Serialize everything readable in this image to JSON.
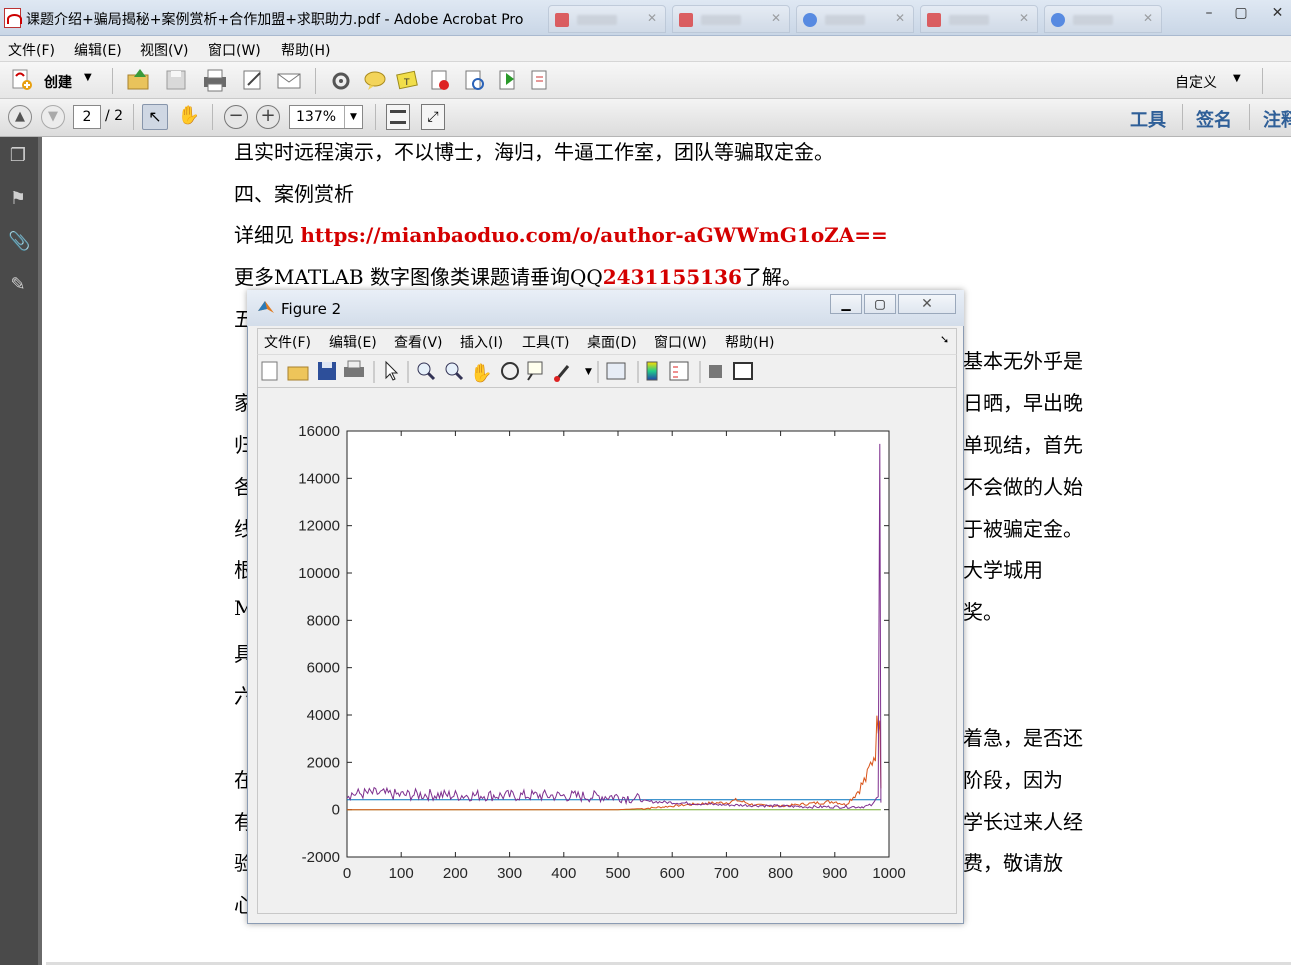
{
  "window": {
    "title": "课题介绍+骗局揭秘+案例赏析+合作加盟+求职助力.pdf - Adobe Acrobat Pro",
    "controls": {
      "minimize": "–",
      "maximize": "▢",
      "close": "✕"
    }
  },
  "menu": [
    "文件(F)",
    "编辑(E)",
    "视图(V)",
    "窗口(W)",
    "帮助(H)"
  ],
  "toolbar": {
    "create_label": "创建",
    "customize_label": "自定义",
    "icons": [
      "open-icon",
      "save-icon",
      "print-icon",
      "edit-icon",
      "email-icon",
      "settings-icon",
      "comment-icon",
      "stamp-icon",
      "delete-page-icon",
      "export-icon",
      "share-icon",
      "form-icon"
    ]
  },
  "nav": {
    "page_current": "2",
    "page_total": "/ 2",
    "zoom": "137%",
    "tools_label": "工具",
    "sign_label": "签名",
    "comment_label": "注释"
  },
  "document": {
    "line1": "且实时远程演示，不以博士，海归，牛逼工作室，团队等骗取定金。",
    "line2": "四、案例赏析",
    "line3_prefix": "详细见 ",
    "line3_link": "https://mianbaoduo.com/o/author-aGWWmG1oZA==",
    "line4_prefix": "更多MATLAB  数字图像类课题请垂询QQ",
    "line4_qq": "2431155136",
    "line4_suffix": "了解。",
    "left_fragments": [
      "五",
      "家",
      "归",
      "各",
      "线",
      "根",
      "M",
      "具",
      "六",
      "在",
      "有",
      "验",
      "心"
    ],
    "right_fragments": [
      "基本无外乎是",
      "日晒，早出晚",
      "单现结，首先",
      "不会做的人始",
      "于被骗定金。",
      "大学城用",
      "奖。",
      "着急，是否还",
      "阶段，因为",
      "学长过来人经",
      "费，敬请放"
    ]
  },
  "figure": {
    "title": "Figure 2",
    "menu": [
      "文件(F)",
      "编辑(E)",
      "查看(V)",
      "插入(I)",
      "工具(T)",
      "桌面(D)",
      "窗口(W)",
      "帮助(H)"
    ],
    "tools": [
      "new-icon",
      "open-icon",
      "save-icon",
      "print-icon",
      "pointer-icon",
      "zoom-in-icon",
      "zoom-out-icon",
      "pan-icon",
      "rotate-icon",
      "datatip-icon",
      "brush-icon",
      "link-icon",
      "colorbar-icon",
      "legend-icon",
      "hide-tools-icon",
      "dock-icon"
    ]
  },
  "chart_data": {
    "type": "line",
    "title": "",
    "xlabel": "",
    "ylabel": "",
    "xlim": [
      0,
      1000
    ],
    "ylim": [
      -2000,
      16000
    ],
    "xticks": [
      0,
      100,
      200,
      300,
      400,
      500,
      600,
      700,
      800,
      900,
      1000
    ],
    "yticks": [
      -2000,
      0,
      2000,
      4000,
      6000,
      8000,
      10000,
      12000,
      14000,
      16000
    ],
    "grid": false,
    "series": [
      {
        "color": "#7e2f8e",
        "x": [
          0,
          50,
          100,
          150,
          200,
          250,
          300,
          350,
          400,
          450,
          500,
          530,
          550,
          600,
          650,
          700,
          750,
          800,
          850,
          900,
          950,
          970,
          980,
          983,
          985
        ],
        "y": [
          650,
          700,
          620,
          640,
          600,
          610,
          590,
          600,
          580,
          560,
          560,
          480,
          350,
          300,
          250,
          200,
          180,
          150,
          120,
          120,
          120,
          200,
          600,
          15500,
          300
        ]
      },
      {
        "color": "#d95319",
        "x": [
          0,
          100,
          200,
          300,
          400,
          500,
          550,
          600,
          650,
          700,
          720,
          750,
          800,
          850,
          900,
          920,
          940,
          960,
          975,
          983,
          985
        ],
        "y": [
          0,
          0,
          0,
          0,
          0,
          0,
          50,
          150,
          250,
          300,
          400,
          200,
          150,
          250,
          350,
          200,
          700,
          1400,
          2600,
          4800,
          900
        ]
      },
      {
        "color": "#0072bd",
        "x": [
          0,
          100,
          200,
          300,
          400,
          500,
          600,
          700,
          800,
          900,
          960,
          980,
          985
        ],
        "y": [
          420,
          420,
          420,
          420,
          420,
          420,
          420,
          420,
          420,
          420,
          420,
          420,
          420
        ]
      },
      {
        "color": "#77ac30",
        "x": [
          0,
          200,
          400,
          600,
          800,
          985
        ],
        "y": [
          0,
          0,
          0,
          0,
          0,
          0
        ]
      }
    ]
  }
}
